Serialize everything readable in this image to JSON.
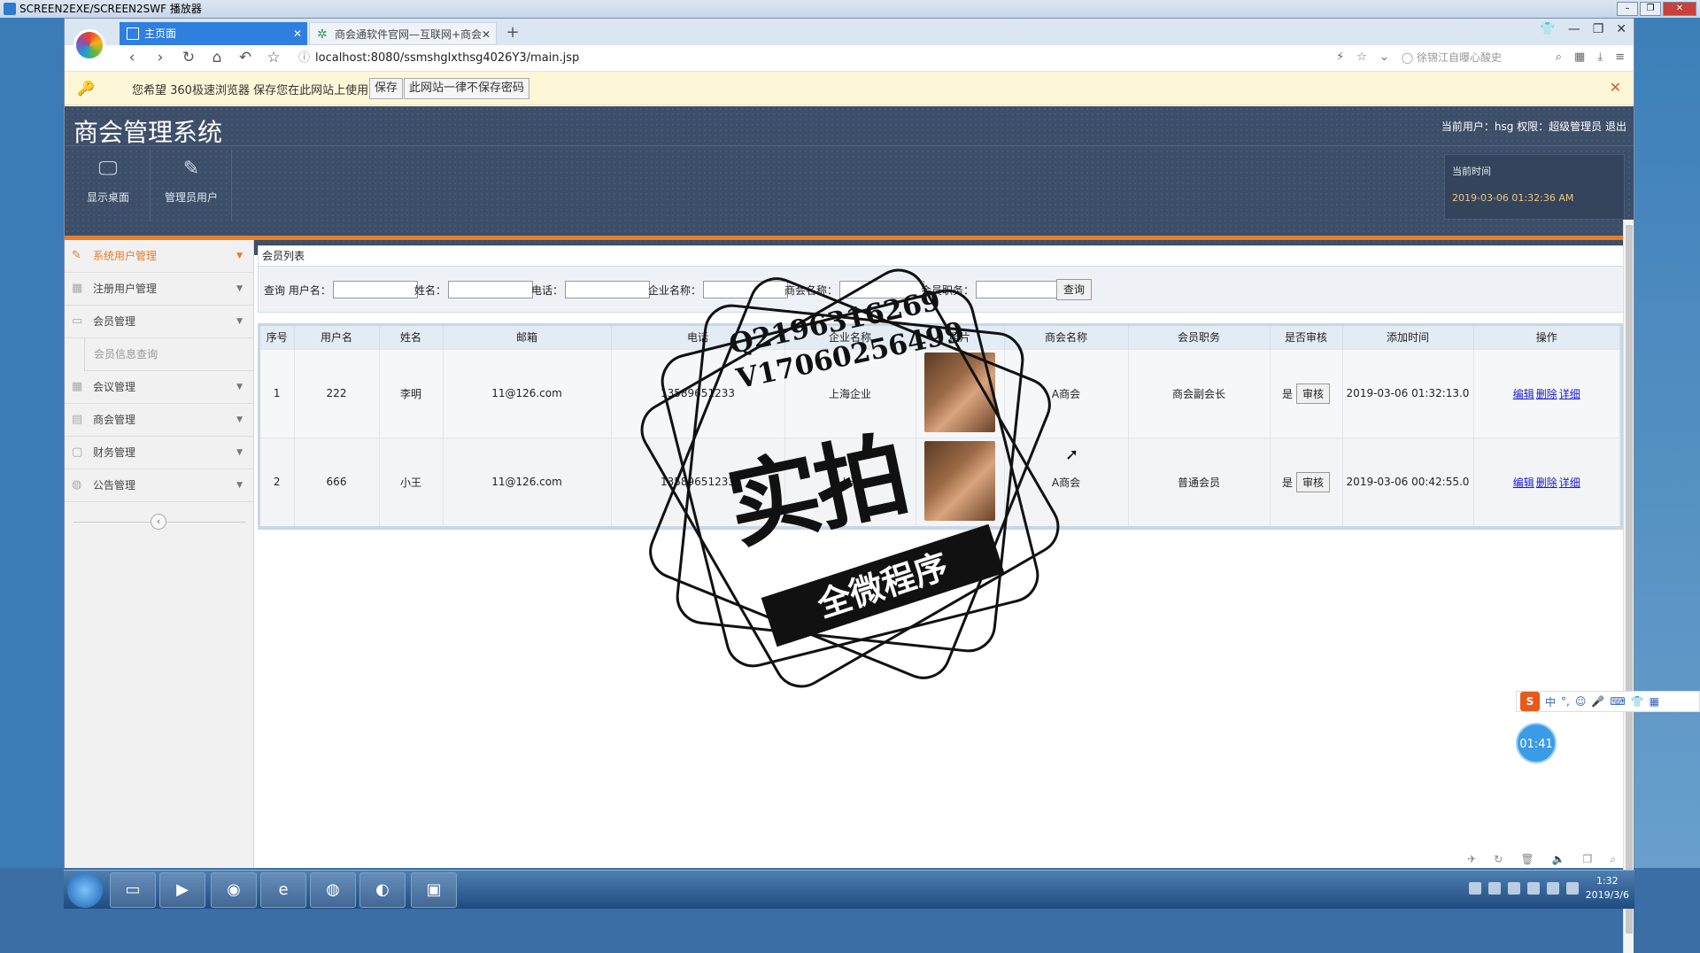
{
  "player": {
    "title": "SCREEN2EXE/SCREEN2SWF 播放器"
  },
  "browser": {
    "tabs": [
      {
        "label": "主页面",
        "active": true
      },
      {
        "label": "商会通软件官网—互联网+商会",
        "active": false
      }
    ],
    "url": "localhost:8080/ssmshglxthsg4026Y3/main.jsp",
    "search_placeholder": "徐锦江自曝心酸史",
    "password_prompt": {
      "message": "您希望 360极速浏览器 保存您在此网站上使用的帐号吗？",
      "save_label": "保存",
      "never_label": "此网站一律不保存密码"
    }
  },
  "app": {
    "title": "商会管理系统",
    "user_info": "当前用户：hsg 权限：超级管理员 退出",
    "top_nav": [
      {
        "label": "显示桌面",
        "icon": "monitor-icon"
      },
      {
        "label": "管理员用户",
        "icon": "pencil-icon"
      }
    ],
    "time": {
      "label": "当前时间",
      "value": "2019-03-06 01:32:36 AM"
    },
    "sidebar": [
      {
        "label": "系统用户管理",
        "active": true
      },
      {
        "label": "注册用户管理"
      },
      {
        "label": "会员管理"
      },
      {
        "label": "会员信息查询",
        "sub": true
      },
      {
        "label": "会议管理"
      },
      {
        "label": "商会管理"
      },
      {
        "label": "财务管理"
      },
      {
        "label": "公告管理"
      }
    ]
  },
  "panel": {
    "title": "会员列表",
    "search": {
      "prefix": "查询",
      "fields": [
        "用户名：",
        "姓名：",
        "电话：",
        "企业名称：",
        "商会名称：",
        "会员职务："
      ],
      "button": "查询"
    },
    "columns": [
      "序号",
      "用户名",
      "姓名",
      "邮箱",
      "电话",
      "企业名称",
      "照片",
      "商会名称",
      "会员职务",
      "是否审核",
      "添加时间",
      "操作"
    ],
    "rows": [
      {
        "idx": "1",
        "username": "222",
        "name": "李明",
        "email": "11@126.com",
        "phone": "13589651233",
        "company": "上海企业",
        "chamber": "A商会",
        "position": "商会副会长",
        "audited": "是",
        "audit_btn": "审核",
        "time": "2019-03-06 01:32:13.0"
      },
      {
        "idx": "2",
        "username": "666",
        "name": "小王",
        "email": "11@126.com",
        "phone": "13589651233",
        "company": "上海",
        "chamber": "A商会",
        "position": "普通会员",
        "audited": "是",
        "audit_btn": "审核",
        "time": "2019-03-06 00:42:55.0"
      }
    ],
    "ops": [
      "编辑",
      "删除",
      "详细"
    ]
  },
  "watermark": {
    "line1": "Q2196316269",
    "line2": "V17060256499",
    "big": "实拍",
    "banner": "全微程序"
  },
  "overlay": {
    "timer": "01:41",
    "ime": "中"
  },
  "taskbar": {
    "time": "1:32",
    "date": "2019/3/6"
  }
}
